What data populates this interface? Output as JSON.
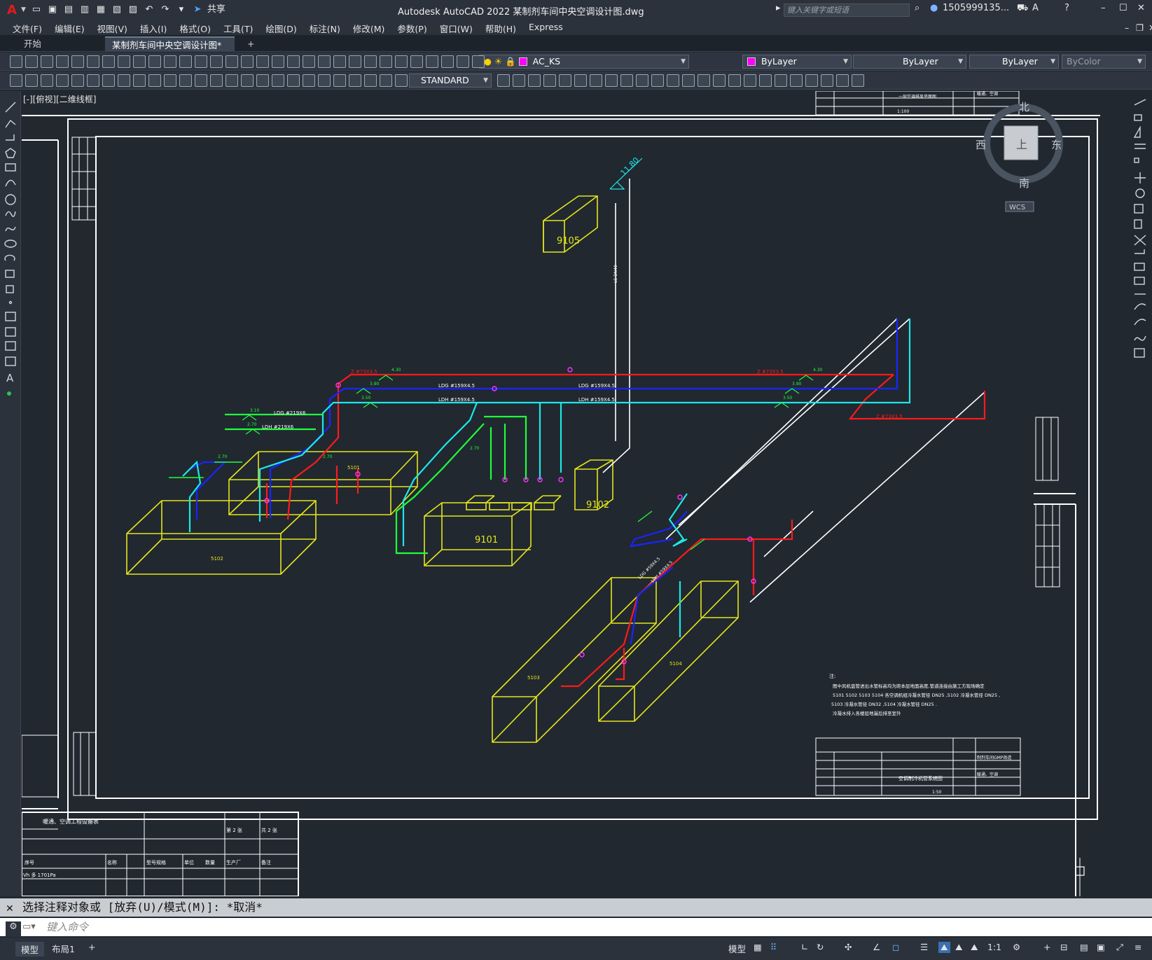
{
  "app": {
    "title": "Autodesk AutoCAD 2022    某制剂车间中央空调设计图.dwg",
    "search_placeholder": "键入关键字或短语",
    "user": "1505999135...",
    "share_label": "共享"
  },
  "menu": [
    "文件(F)",
    "编辑(E)",
    "视图(V)",
    "插入(I)",
    "格式(O)",
    "工具(T)",
    "绘图(D)",
    "标注(N)",
    "修改(M)",
    "参数(P)",
    "窗口(W)",
    "帮助(H)",
    "Express"
  ],
  "tabs": {
    "start": "开始",
    "active": "某制剂车间中央空调设计图*",
    "close": "✕",
    "add": "+"
  },
  "toolbar": {
    "layer": "AC_KS",
    "color": "ByLayer",
    "linetype": "ByLayer",
    "lineweight": "ByLayer",
    "plotstyle": "ByColor",
    "textstyle": "STANDARD"
  },
  "viewport": {
    "label": "[-][俯视][二维线框]"
  },
  "viewcube": {
    "north": "北",
    "south": "南",
    "west": "西",
    "east": "东",
    "top": "上",
    "wcs": "WCS"
  },
  "drawing": {
    "equip": [
      "9105",
      "9102",
      "9101",
      "5101",
      "5102",
      "5103",
      "5104"
    ],
    "pipes": {
      "red_top": "Z #73X3.5",
      "blue_top": "LDG #159X4.5",
      "blue_top2": "LDG #159X4.5",
      "cyan_top": "LDH #159X4.5",
      "cyan_top2": "LDH #159X4.5",
      "green1": "LDG #219X6",
      "green2": "LDH #219X6",
      "red_right": "Z #73X3.5",
      "elev_top": "11.80",
      "elev1": "4.30",
      "elev2": "3.90",
      "elev3": "3.50",
      "elev4": "2.70",
      "elev5": "3.10",
      "vertical": "LS DN40",
      "ldg_small": "LDG #59X4.5",
      "ldh_small": "LDH #59X4.5"
    },
    "notes": {
      "head": "注:",
      "line1": "   图中风机盘管进出水管标高均为距本层地面高度,管道连接由施工方现场确定",
      "line2": "   5101 5102 5103 5104 各空调机组冷凝水管径 DN25 ,5102 冷凝水管径 DN25 ,",
      "line3": "   5103 冷凝水管径 DN32 ,5104 冷凝水管径 DN25 .",
      "line4": "   冷凝水排入各楼层地漏后排至室外"
    },
    "titleblock": {
      "name": "空调制冷机管系统图",
      "top_name": "一层空调排风平面图",
      "scale": "1:50",
      "scale_top": "1:100",
      "proj": "制剂车间GMP改造",
      "unit": "暖通、空调"
    },
    "bottom_table": {
      "title": "暖通、空调工程设备表",
      "ver": "第 2 张",
      "sheet": "共 2 张",
      "cols": [
        "序号",
        "名称",
        "型号规格",
        "单位",
        "数量",
        "生产厂",
        "备注"
      ],
      "row1": "Vh 多 1701Pa"
    }
  },
  "command": {
    "history": "选择注释对象或 [放弃(U)/模式(M)]: *取消*",
    "placeholder": "键入命令"
  },
  "status": {
    "tab_model": "模型",
    "tab_layout": "布局1",
    "add": "+",
    "model_btn": "模型",
    "scale": "1:1"
  },
  "colors": {
    "red": "#ff1a1a",
    "blue": "#1a24ff",
    "cyan": "#1ee8e8",
    "green": "#1fff3a",
    "yellow": "#e6e61a",
    "magenta": "#ff33ff",
    "white": "#ffffff",
    "bg": "#212830"
  }
}
